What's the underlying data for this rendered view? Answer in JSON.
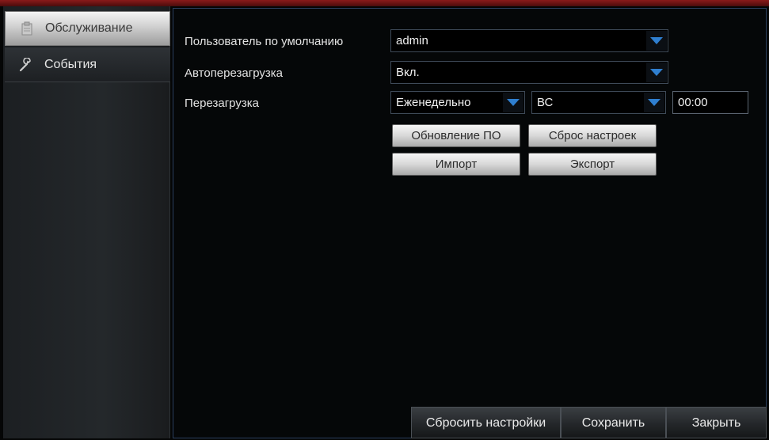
{
  "colors": {
    "accent_arrow": "#2f7fd0",
    "panel_border": "#2b3f5e",
    "top_line": "#8a1a1a"
  },
  "sidebar": {
    "items": [
      {
        "label": "Обслуживание",
        "icon": "maintenance-icon",
        "active": true
      },
      {
        "label": "События",
        "icon": "wrench-icon",
        "active": false
      }
    ]
  },
  "form": {
    "default_user": {
      "label": "Пользователь по умолчанию",
      "value": "admin"
    },
    "auto_reboot": {
      "label": "Автоперезагрузка",
      "value": "Вкл."
    },
    "reboot": {
      "label": "Перезагрузка",
      "period": "Еженедельно",
      "day": "ВС",
      "time": "00:00"
    }
  },
  "buttons": {
    "firmware_update": "Обновление ПО",
    "factory_reset": "Сброс настроек",
    "import": "Импорт",
    "export": "Экспорт"
  },
  "footer": {
    "reset": "Сбросить настройки",
    "save": "Сохранить",
    "close": "Закрыть"
  }
}
